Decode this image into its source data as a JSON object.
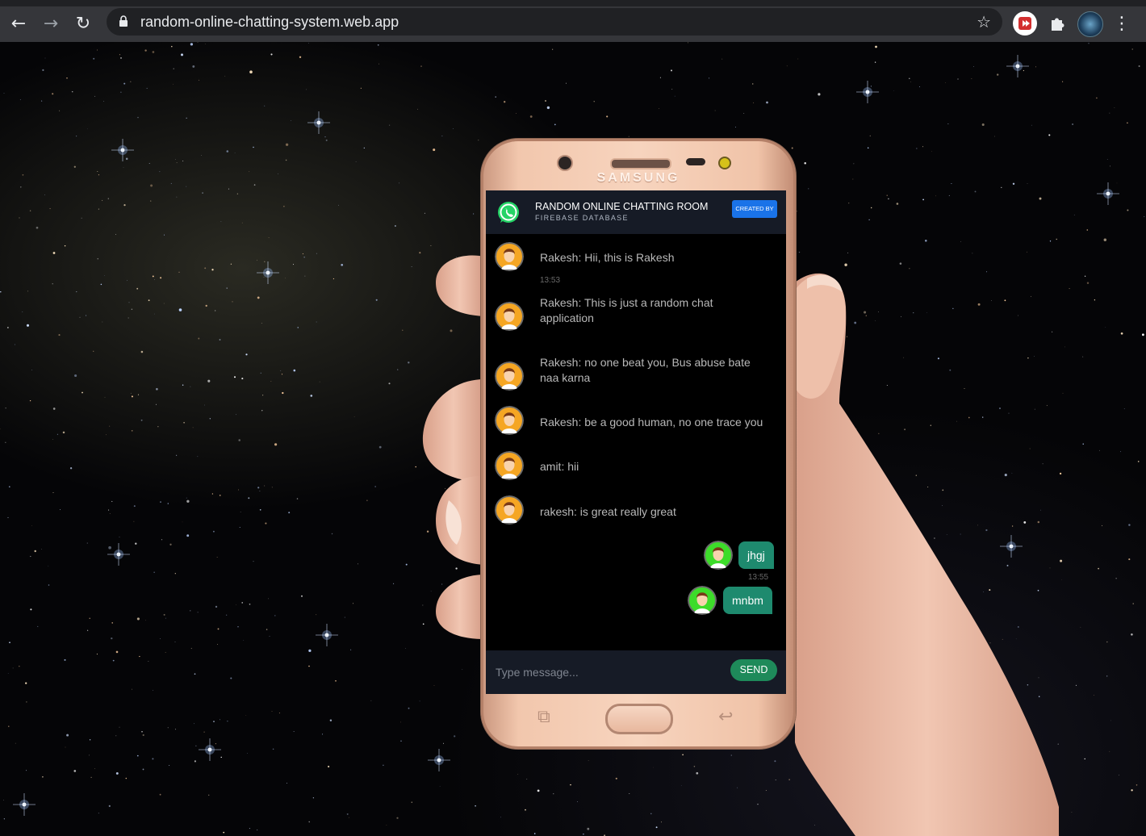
{
  "browser": {
    "url": "random-online-chatting-system.web.app",
    "back_glyph": "←",
    "forward_glyph": "→",
    "reload_glyph": "↻",
    "star_glyph": "☆",
    "menu_glyph": "⋮",
    "icons": [
      "back-icon",
      "forward-icon",
      "reload-icon",
      "lock-icon",
      "star-icon",
      "extension-red-icon",
      "puzzle-icon",
      "profile-avatar",
      "menu-icon"
    ]
  },
  "phone": {
    "brand": "SAMSUNG",
    "recent_glyph": "⧉",
    "back_glyph": "↩"
  },
  "app": {
    "title": "RANDOM ONLINE CHATTING ROOM",
    "subtitle": "FIREBASE DATABASE",
    "created_by": "CREATED BY",
    "input_placeholder": "Type message...",
    "send_label": "SEND",
    "accent_color": "#1e8a6e",
    "button_color": "#1a73e8"
  },
  "messages": [
    {
      "text": "Rakesh: Hii, this is Rakesh",
      "time": "13:53",
      "side": "left"
    },
    {
      "text": "Rakesh: This is just a random chat application",
      "time": "",
      "side": "left"
    },
    {
      "text": "Rakesh: no one beat you, Bus abuse bate naa karna",
      "time": "",
      "side": "left"
    },
    {
      "text": "Rakesh: be a good human, no one trace you",
      "time": "",
      "side": "left"
    },
    {
      "text": "amit: hii",
      "time": "",
      "side": "left"
    },
    {
      "text": "rakesh: is great really great",
      "time": "",
      "side": "left"
    },
    {
      "text": "jhgj",
      "time": "13:55",
      "side": "right"
    },
    {
      "text": "mnbm",
      "time": "",
      "side": "right"
    }
  ]
}
